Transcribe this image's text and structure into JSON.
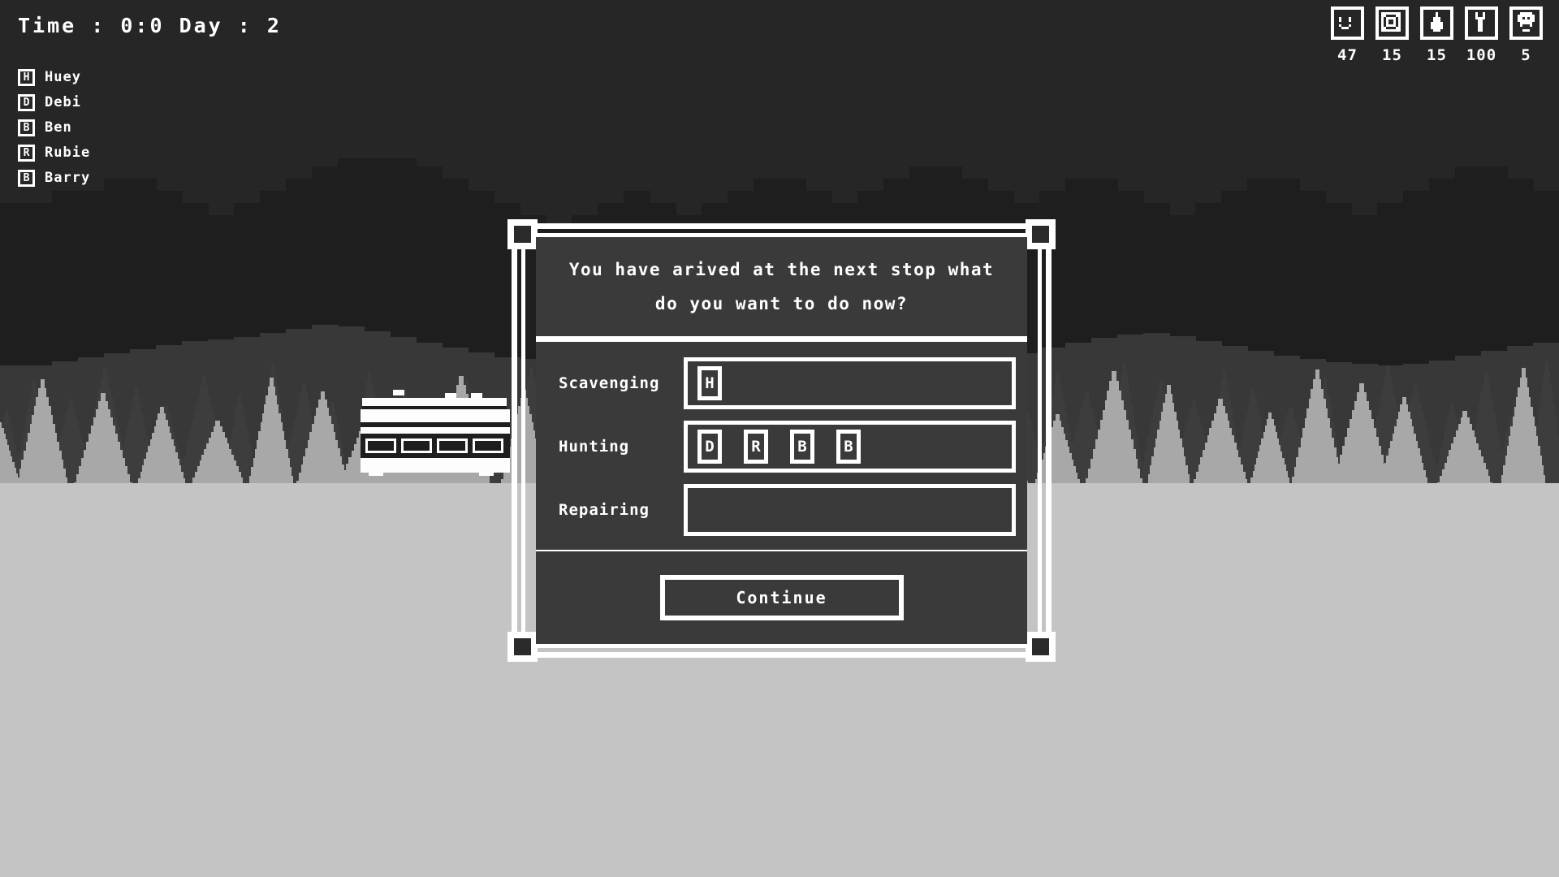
{
  "hud": {
    "clock": "Time : 0:0 Day : 2",
    "time_label": "Time",
    "time_value": "0:0",
    "day_label": "Day",
    "day_value": "2",
    "crew": [
      {
        "token": "H",
        "name": "Huey"
      },
      {
        "token": "D",
        "name": "Debi"
      },
      {
        "token": "B",
        "name": "Ben"
      },
      {
        "token": "R",
        "name": "Rubie"
      },
      {
        "token": "B",
        "name": "Barry"
      }
    ],
    "resources": [
      {
        "icon": "smiley-face-icon",
        "value": "47"
      },
      {
        "icon": "crate-icon",
        "value": "15"
      },
      {
        "icon": "fuel-drop-icon",
        "value": "15"
      },
      {
        "icon": "wrench-icon",
        "value": "100"
      },
      {
        "icon": "meat-head-icon",
        "value": "5"
      }
    ]
  },
  "dialog": {
    "message": "You have arived at the next stop what do you want to do now?",
    "rows": [
      {
        "label": "Scavenging",
        "tokens": [
          "H"
        ]
      },
      {
        "label": "Hunting",
        "tokens": [
          "D",
          "R",
          "B",
          "B"
        ]
      },
      {
        "label": "Repairing",
        "tokens": []
      }
    ],
    "continue_label": "Continue"
  },
  "colors": {
    "sky": "#262626",
    "hills_far": "#1e1e1e",
    "hills_mid": "#383838",
    "trees_dark": "#3d3d3d",
    "trees_light": "#a8a8a8",
    "ground": "#c4c4c4",
    "panel": "#3a3a3a",
    "outline": "#ffffff",
    "text": "#ffffff"
  }
}
